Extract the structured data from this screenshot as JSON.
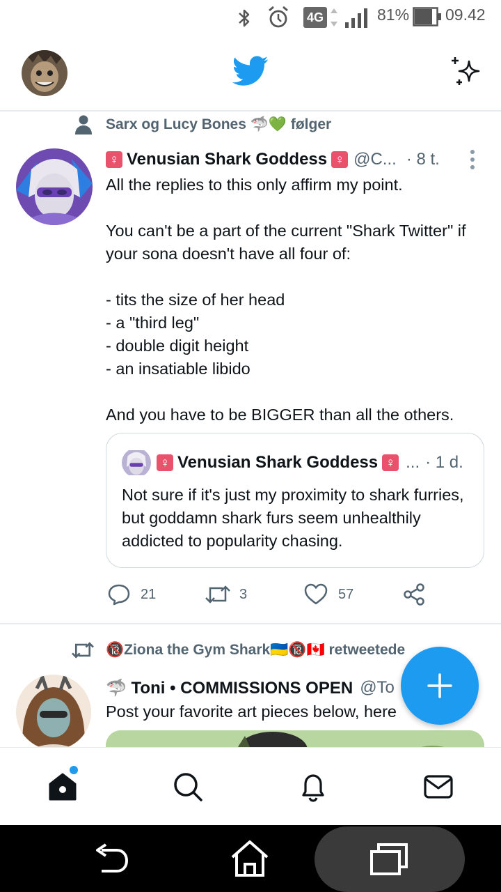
{
  "status_bar": {
    "network": "4G",
    "battery": "81%",
    "time": "09.42",
    "icons": [
      "bluetooth-icon",
      "alarm-icon",
      "signal-icon",
      "battery-icon"
    ]
  },
  "header": {
    "logo": "twitter-bird-icon",
    "colors": {
      "brand": "#1d9bf0",
      "secondary_text": "#536471"
    }
  },
  "tweets": [
    {
      "context": "Sarx og Lucy Bones 🦈💚 følger",
      "name": "Venusian Shark Goddess",
      "name_emoji": "♀",
      "handle": "@C...",
      "time": "· 8 t.",
      "text": "All the replies to this only affirm my point.\n\nYou can't be a part of the current \"Shark Twitter\" if your sona doesn't have all four of:\n\n- tits the size of her head\n- a \"third leg\"\n- double digit height\n- an insatiable libido\n\nAnd you have to be BIGGER than all the others.",
      "quote": {
        "name": "Venusian Shark Goddess",
        "handle": "...",
        "time": "· 1 d.",
        "text": "Not sure if it's just my proximity to shark furries, but goddamn shark furs seem unhealthily addicted to popularity chasing."
      },
      "actions": {
        "replies": "21",
        "retweets": "3",
        "likes": "57"
      }
    },
    {
      "context": "🔞Ziona the Gym Shark🇺🇦🔞🇨🇦 retweetede",
      "name": "🦈 Toni • COMMISSIONS OPEN",
      "handle": "@To",
      "text": "Post your favorite art pieces below, here"
    }
  ],
  "bottom_nav": [
    "home-icon",
    "search-icon",
    "notifications-icon",
    "messages-icon"
  ]
}
